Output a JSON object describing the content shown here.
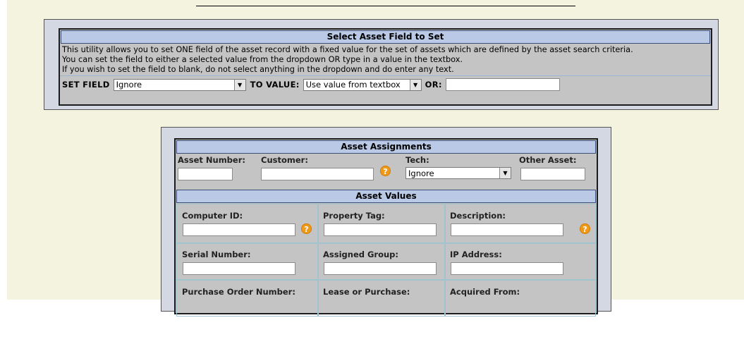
{
  "set_field_panel": {
    "title": "Select Asset Field to Set",
    "description": [
      "This utility allows you to set ONE field of the asset record with a fixed value for the set of assets which are defined by the asset search criteria.",
      "You can set the field to either a selected value from the dropdown OR type in a value in the textbox.",
      "If you wish to set the field to blank, do not select anything in the dropdown and do enter any text."
    ],
    "set_field_label": "SET FIELD",
    "set_field_value": "Ignore",
    "to_value_label": "TO VALUE:",
    "to_value_value": "Use value from textbox",
    "or_label": "OR:",
    "or_input_value": ""
  },
  "asset_assignments": {
    "title": "Asset Assignments",
    "asset_number_label": "Asset Number:",
    "customer_label": "Customer:",
    "tech_label": "Tech:",
    "tech_value": "Ignore",
    "other_asset_label": "Other Asset:"
  },
  "asset_values": {
    "title": "Asset Values",
    "computer_id_label": "Computer ID:",
    "property_tag_label": "Property Tag:",
    "description_label": "Description:",
    "serial_number_label": "Serial Number:",
    "assigned_group_label": "Assigned Group:",
    "ip_address_label": "IP Address:",
    "purchase_order_label": "Purchase Order Number:",
    "lease_purchase_label": "Lease or Purchase:",
    "acquired_from_label": "Acquired From:"
  },
  "icons": {
    "help": "help-icon",
    "dropdown": "chevron-down-icon"
  },
  "colors": {
    "page_background": "#f4f3df",
    "frame_background": "#d3d8e3",
    "panel_background": "#c4c4c4",
    "header_background": "#b9c9e6",
    "help_icon": "#f09a18"
  }
}
